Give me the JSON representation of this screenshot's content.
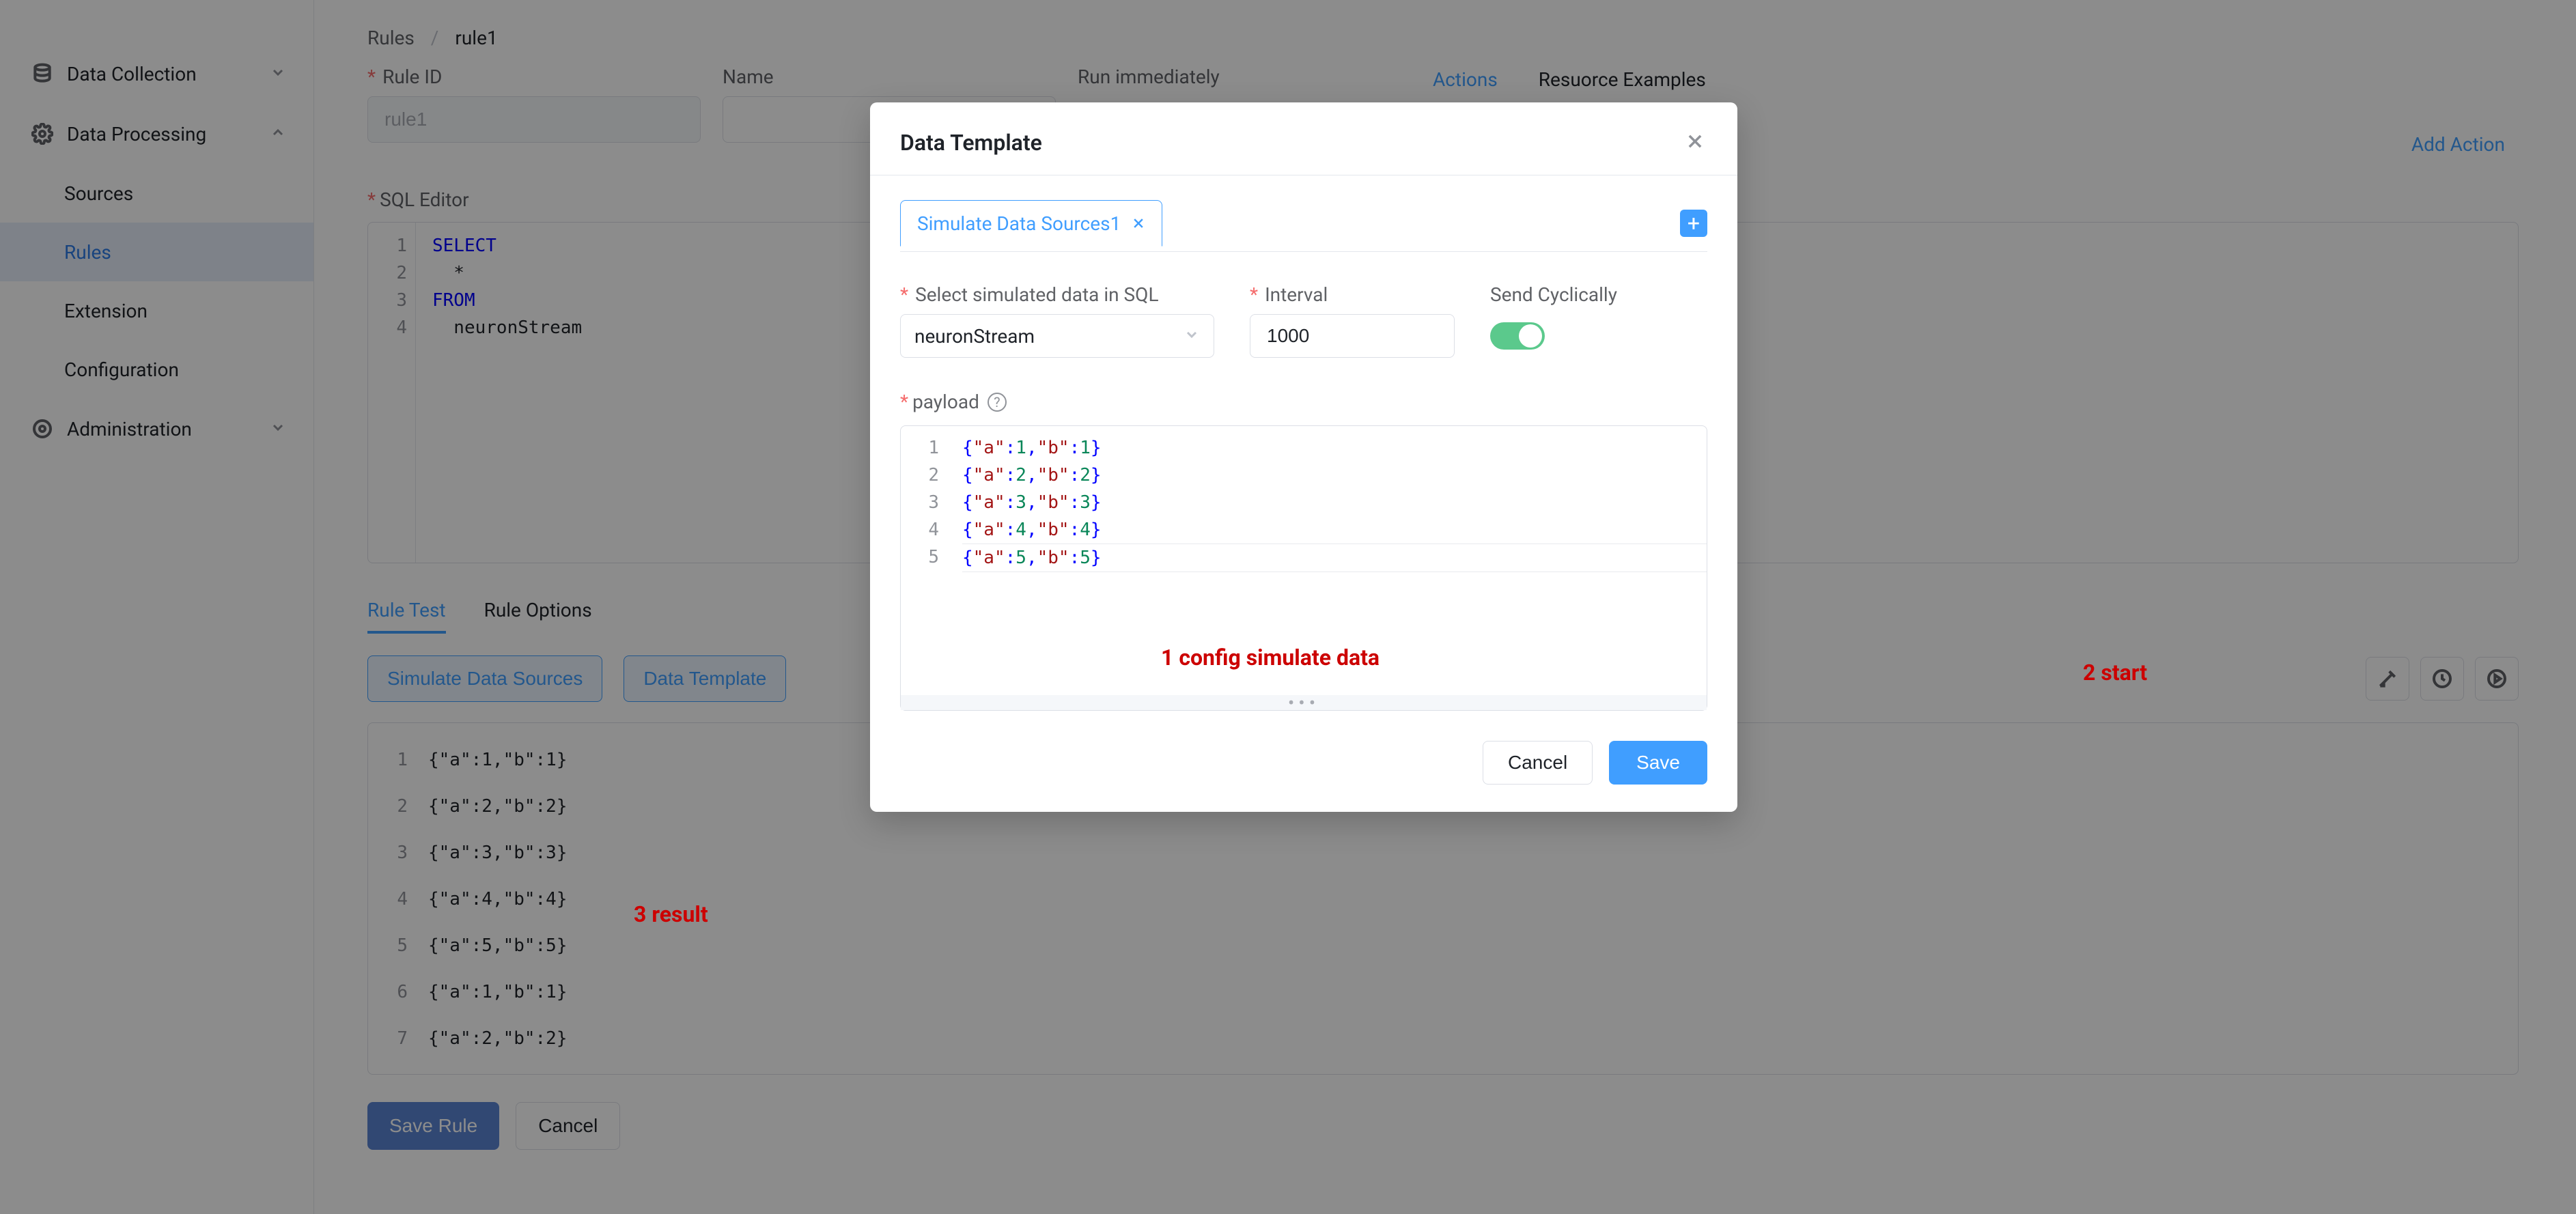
{
  "sidebar": {
    "groups": [
      {
        "label": "Data Collection",
        "expanded": false
      },
      {
        "label": "Data Processing",
        "expanded": true,
        "items": [
          {
            "label": "Sources"
          },
          {
            "label": "Rules",
            "active": true
          },
          {
            "label": "Extension"
          },
          {
            "label": "Configuration"
          }
        ]
      },
      {
        "label": "Administration",
        "expanded": false
      }
    ]
  },
  "breadcrumbs": {
    "root": "Rules",
    "current": "rule1"
  },
  "form": {
    "rule_id_label": "Rule ID",
    "rule_id_value": "rule1",
    "name_label": "Name",
    "name_value": "",
    "run_label": "Run immediately",
    "right_tabs": {
      "actions": "Actions",
      "resources": "Resuorce Examples"
    },
    "add_action": "Add Action",
    "sql_label": "SQL Editor",
    "sql_lines": [
      "SELECT",
      "  *",
      "FROM",
      "  neuronStream"
    ]
  },
  "tabs2": {
    "rule_test": "Rule Test",
    "rule_options": "Rule Options"
  },
  "toolbar": {
    "simulate": "Simulate Data Sources",
    "template": "Data Template"
  },
  "results": [
    "{\"a\":1,\"b\":1}",
    "{\"a\":2,\"b\":2}",
    "{\"a\":3,\"b\":3}",
    "{\"a\":4,\"b\":4}",
    "{\"a\":5,\"b\":5}",
    "{\"a\":1,\"b\":1}",
    "{\"a\":2,\"b\":2}"
  ],
  "footer": {
    "save": "Save Rule",
    "cancel": "Cancel"
  },
  "annotations": {
    "a1": "1 config simulate data",
    "a2": "2 start",
    "a3": "3 result"
  },
  "modal": {
    "title": "Data Template",
    "tab_label": "Simulate Data Sources1",
    "select_label": "Select simulated data in SQL",
    "select_value": "neuronStream",
    "interval_label": "Interval",
    "interval_value": "1000",
    "cyclic_label": "Send Cyclically",
    "payload_label": "payload",
    "payload_lines": [
      "{\"a\":1,\"b\":1}",
      "{\"a\":2,\"b\":2}",
      "{\"a\":3,\"b\":3}",
      "{\"a\":4,\"b\":4}",
      "{\"a\":5,\"b\":5}"
    ],
    "cancel": "Cancel",
    "save": "Save"
  }
}
